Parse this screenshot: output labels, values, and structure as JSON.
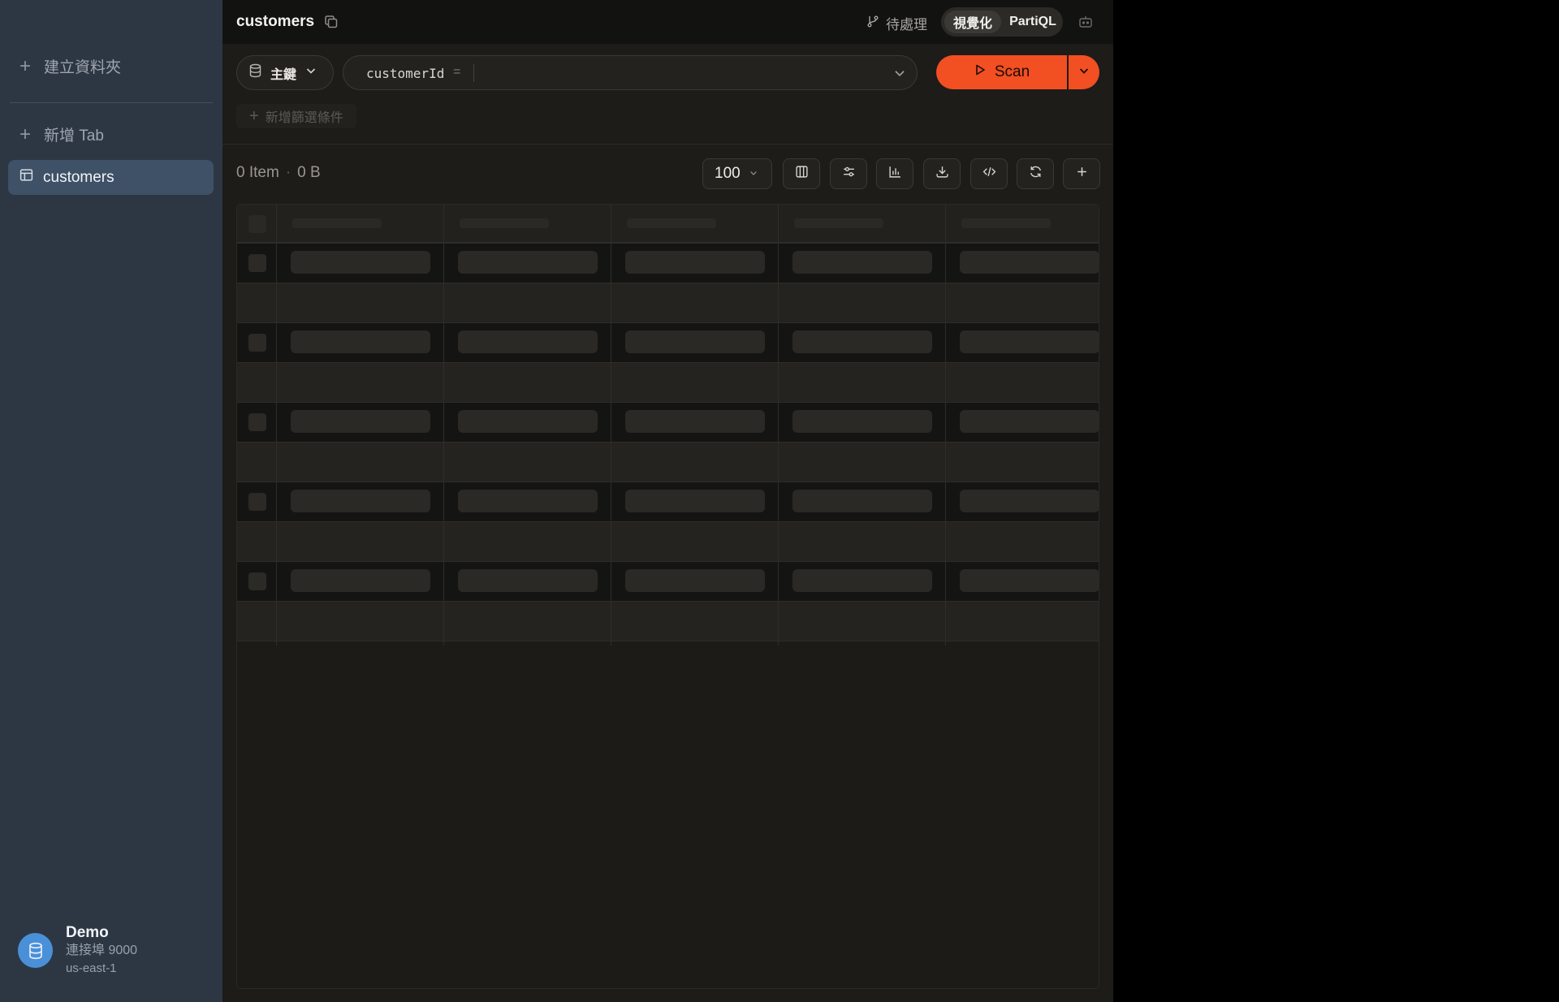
{
  "sidebar": {
    "new_folder_label": "建立資料夾",
    "new_tab_label": "新增 Tab",
    "tabs": [
      {
        "label": "customers",
        "icon": "table-icon",
        "active": true
      }
    ],
    "connection": {
      "name": "Demo",
      "port": "連接埠 9000",
      "region": "us-east-1",
      "icon": "database-icon"
    }
  },
  "header": {
    "title": "customers",
    "pending_label": "待處理",
    "mode_visual": "視覺化",
    "mode_partiql": "PartiQL",
    "active_mode": "視覺化"
  },
  "query": {
    "key_type_label": "主鍵",
    "key_attribute": "customerId",
    "operator": "=",
    "key_value": "",
    "scan_label": "Scan",
    "add_filter_label": "新增篩選條件"
  },
  "results": {
    "item_count": "0 Item",
    "size": "0 B",
    "limit": "100",
    "toolbar_icons": [
      "columns-icon",
      "filter-settings-icon",
      "chart-icon",
      "download-icon",
      "code-icon",
      "refresh-icon",
      "plus-icon"
    ],
    "state": "loading-skeleton"
  },
  "colors": {
    "sidebar_bg": "#2d3744",
    "active_tab_bg": "#3f5167",
    "main_bg": "#1d1c19",
    "accent": "#f24f22",
    "avatar": "#4a90d9"
  }
}
